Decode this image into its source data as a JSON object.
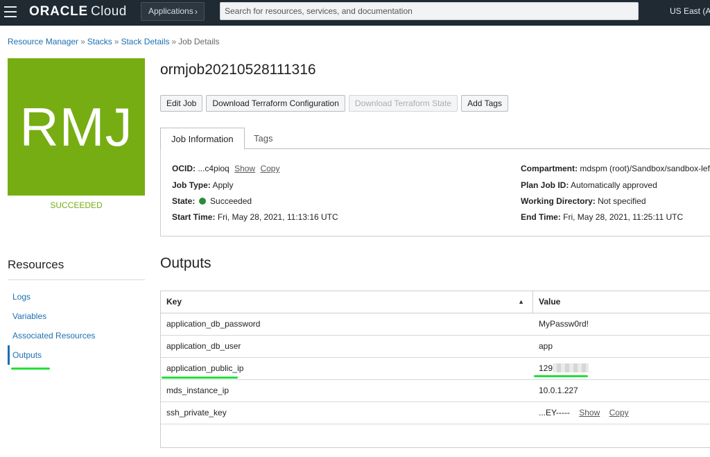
{
  "topbar": {
    "brand_main": "ORACLE",
    "brand_sub": "Cloud",
    "apps_label": "Applications",
    "search_placeholder": "Search for resources, services, and documentation",
    "region": "US East (As"
  },
  "breadcrumb": {
    "items": [
      "Resource Manager",
      "Stacks",
      "Stack Details"
    ],
    "current": "Job Details",
    "separator": "»"
  },
  "tile": {
    "initials": "RMJ",
    "status": "SUCCEEDED",
    "color": "#76ad12"
  },
  "resources": {
    "title": "Resources",
    "items": [
      "Logs",
      "Variables",
      "Associated Resources",
      "Outputs"
    ],
    "active": "Outputs"
  },
  "job": {
    "title": "ormjob20210528111316",
    "buttons": {
      "edit": "Edit Job",
      "download_config": "Download Terraform Configuration",
      "download_state": "Download Terraform State",
      "add_tags": "Add Tags"
    }
  },
  "tabs": [
    "Job Information",
    "Tags"
  ],
  "job_info": {
    "ocid_label": "OCID:",
    "ocid_value": "...c4pioq",
    "show": "Show",
    "copy": "Copy",
    "job_type_label": "Job Type:",
    "job_type_value": "Apply",
    "state_label": "State:",
    "state_value": "Succeeded",
    "start_label": "Start Time:",
    "start_value": "Fri, May 28, 2021, 11:13:16 UTC",
    "compartment_label": "Compartment:",
    "compartment_value": "mdspm (root)/Sandbox/sandbox-lefred",
    "plan_label": "Plan Job ID:",
    "plan_value": "Automatically approved",
    "workdir_label": "Working Directory:",
    "workdir_value": "Not specified",
    "end_label": "End Time:",
    "end_value": "Fri, May 28, 2021, 11:25:11 UTC",
    "state_color": "#2b8a3e"
  },
  "outputs": {
    "title": "Outputs",
    "columns": [
      "Key",
      "Value"
    ],
    "rows": [
      {
        "key": "application_db_password",
        "value": "MyPassw0rd!"
      },
      {
        "key": "application_db_user",
        "value": "app"
      },
      {
        "key": "application_public_ip",
        "value": "129"
      },
      {
        "key": "mds_instance_ip",
        "value": "10.0.1.227"
      },
      {
        "key": "ssh_private_key",
        "value": "...EY-----"
      }
    ],
    "show": "Show",
    "copy": "Copy"
  },
  "colors": {
    "link": "#1a6fb2",
    "highlight": "#22e03b",
    "topbar": "#1f2a33"
  }
}
